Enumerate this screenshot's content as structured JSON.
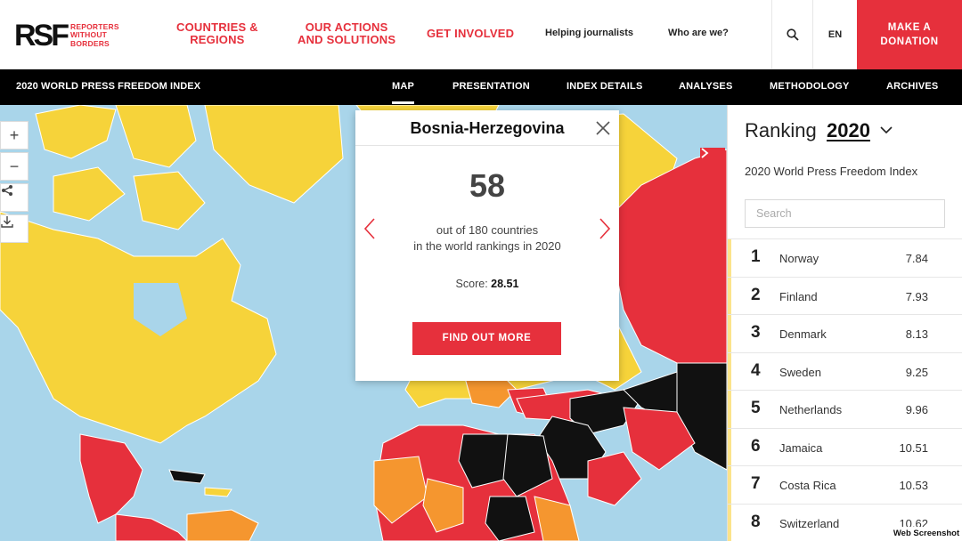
{
  "header": {
    "logo_mark": "RSF",
    "logo_sub_line1": "Reporters",
    "logo_sub_line2": "without borders",
    "nav_countries_1": "Countries &",
    "nav_countries_2": "Regions",
    "nav_actions_1": "Our actions",
    "nav_actions_2": "and solutions",
    "nav_involved": "Get involved",
    "nav_helping": "Helping journalists",
    "nav_who": "Who are we?",
    "lang": "EN",
    "donate_1": "Make a",
    "donate_2": "donation",
    "search_icon": "search-icon"
  },
  "subnav": {
    "title": "2020 WORLD PRESS FREEDOM INDEX",
    "items": [
      {
        "label": "MAP",
        "active": true
      },
      {
        "label": "PRESENTATION",
        "active": false
      },
      {
        "label": "INDEX DETAILS",
        "active": false
      },
      {
        "label": "ANALYSES",
        "active": false
      },
      {
        "label": "METHODOLOGY",
        "active": false
      },
      {
        "label": "ARCHIVES",
        "active": false
      }
    ]
  },
  "map_controls": {
    "zoom_in": "+",
    "zoom_out": "−",
    "share_icon": "share-icon",
    "download_icon": "download-icon",
    "expand_icon": "chevron-right-icon"
  },
  "popup": {
    "country": "Bosnia-Herzegovina",
    "rank": "58",
    "desc_line1": "out of 180 countries",
    "desc_line2": "in the world rankings in 2020",
    "score_label": "Score: ",
    "score_value": "28.51",
    "button": "Find out more"
  },
  "ranking": {
    "heading": "Ranking",
    "year": "2020",
    "subtitle": "2020 World Press Freedom Index",
    "search_placeholder": "Search",
    "rows": [
      {
        "rank": "1",
        "country": "Norway",
        "score": "7.84"
      },
      {
        "rank": "2",
        "country": "Finland",
        "score": "7.93"
      },
      {
        "rank": "3",
        "country": "Denmark",
        "score": "8.13"
      },
      {
        "rank": "4",
        "country": "Sweden",
        "score": "9.25"
      },
      {
        "rank": "5",
        "country": "Netherlands",
        "score": "9.96"
      },
      {
        "rank": "6",
        "country": "Jamaica",
        "score": "10.51"
      },
      {
        "rank": "7",
        "country": "Costa Rica",
        "score": "10.53"
      },
      {
        "rank": "8",
        "country": "Switzerland",
        "score": "10.62"
      }
    ]
  },
  "colors": {
    "accent": "#e6303c",
    "ocean": "#a9d5ea",
    "good": "#f6d33a",
    "problematic": "#f5962f",
    "difficult": "#e6303c",
    "very_serious": "#111111"
  },
  "watermark": "Web Screenshot"
}
